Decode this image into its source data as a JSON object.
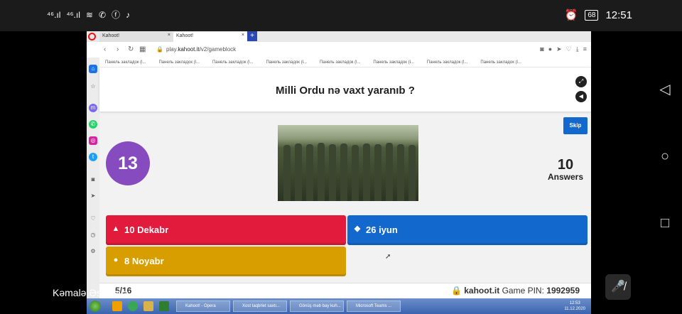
{
  "phone_status": {
    "signal_1": "⁴⁶.ıl",
    "signal_2": "⁴⁶.ıl",
    "time": "12:51",
    "battery": "68"
  },
  "browser": {
    "tabs": [
      {
        "label": "Kahoot!"
      },
      {
        "label": "Kahoot!"
      }
    ],
    "url_prefix": "play.",
    "url_domain": "kahoot.it",
    "url_path": "/v2/gameblock",
    "bookmark_label": "Панель закладок (l..."
  },
  "game": {
    "question": "Milli Ordu nə vaxt yaranıb ?",
    "skip_label": "Skip",
    "timer": "13",
    "answers_count": "10",
    "answers_label": "Answers",
    "choices": [
      {
        "label": "10 Dekabr",
        "color": "#e21b3c",
        "shape": "triangle-icon"
      },
      {
        "label": "26 iyun",
        "color": "#1368ce",
        "shape": "diamond-icon"
      },
      {
        "label": "8 Noyabr",
        "color": "#d89e00",
        "shape": "circle-icon"
      }
    ],
    "progress": "5/16",
    "site": "kahoot.it",
    "pin_label": "Game PIN:",
    "pin": "1992959"
  },
  "taskbar": {
    "items": [
      "Kahoot! - Opera",
      "Xost taqbrlet saxtı...",
      "Gönüş məb bay kuh...",
      "Microsoft Teams ..."
    ],
    "time": "12:53",
    "date": "11.12.2020"
  },
  "meeting": {
    "participant": "Kəmalə Əsədova"
  }
}
